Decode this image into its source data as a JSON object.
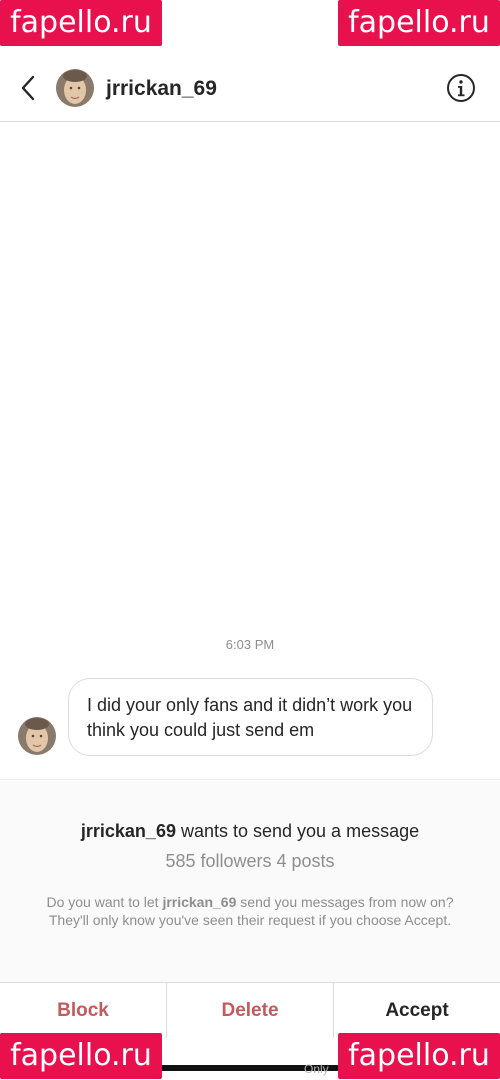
{
  "header": {
    "username": "jrrickan_69",
    "back_icon": "chevron-left-icon",
    "info_icon": "info-icon"
  },
  "chat": {
    "timestamp": "6:03 PM",
    "message": "I did your only fans and it didn’t work you think you could just send em"
  },
  "request": {
    "username": "jrrickan_69",
    "title_suffix": " wants to send you a message",
    "stats": "585 followers 4 posts",
    "desc_prefix": "Do you want to let ",
    "desc_username": "jrrickan_69",
    "desc_suffix": " send you messages from now on? They'll only know you've seen their request if you choose Accept."
  },
  "actions": {
    "block_label": "Block",
    "delete_label": "Delete",
    "accept_label": "Accept"
  },
  "footer_text": "Only",
  "watermark": "fapello.ru",
  "colors": {
    "danger": "#c25a5e",
    "watermark_bg": "#e8114e",
    "secondary_text": "#8e8e8e"
  }
}
